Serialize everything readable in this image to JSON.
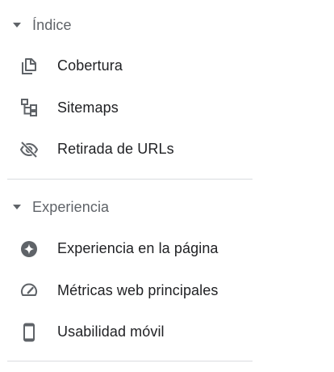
{
  "sections": [
    {
      "title": "Índice",
      "expanded": true,
      "items": [
        {
          "label": "Cobertura",
          "icon": "coverage-copy-icon"
        },
        {
          "label": "Sitemaps",
          "icon": "sitemap-tree-icon"
        },
        {
          "label": "Retirada de URLs",
          "icon": "visibility-off-icon"
        }
      ]
    },
    {
      "title": "Experiencia",
      "expanded": true,
      "items": [
        {
          "label": "Experiencia en la página",
          "icon": "page-experience-star-icon"
        },
        {
          "label": "Métricas web principales",
          "icon": "speed-gauge-icon"
        },
        {
          "label": "Usabilidad móvil",
          "icon": "smartphone-icon"
        }
      ]
    }
  ],
  "colors": {
    "header_text": "#5f6368",
    "item_text": "#202124",
    "icon": "#5f6368",
    "divider": "#dadce0"
  }
}
